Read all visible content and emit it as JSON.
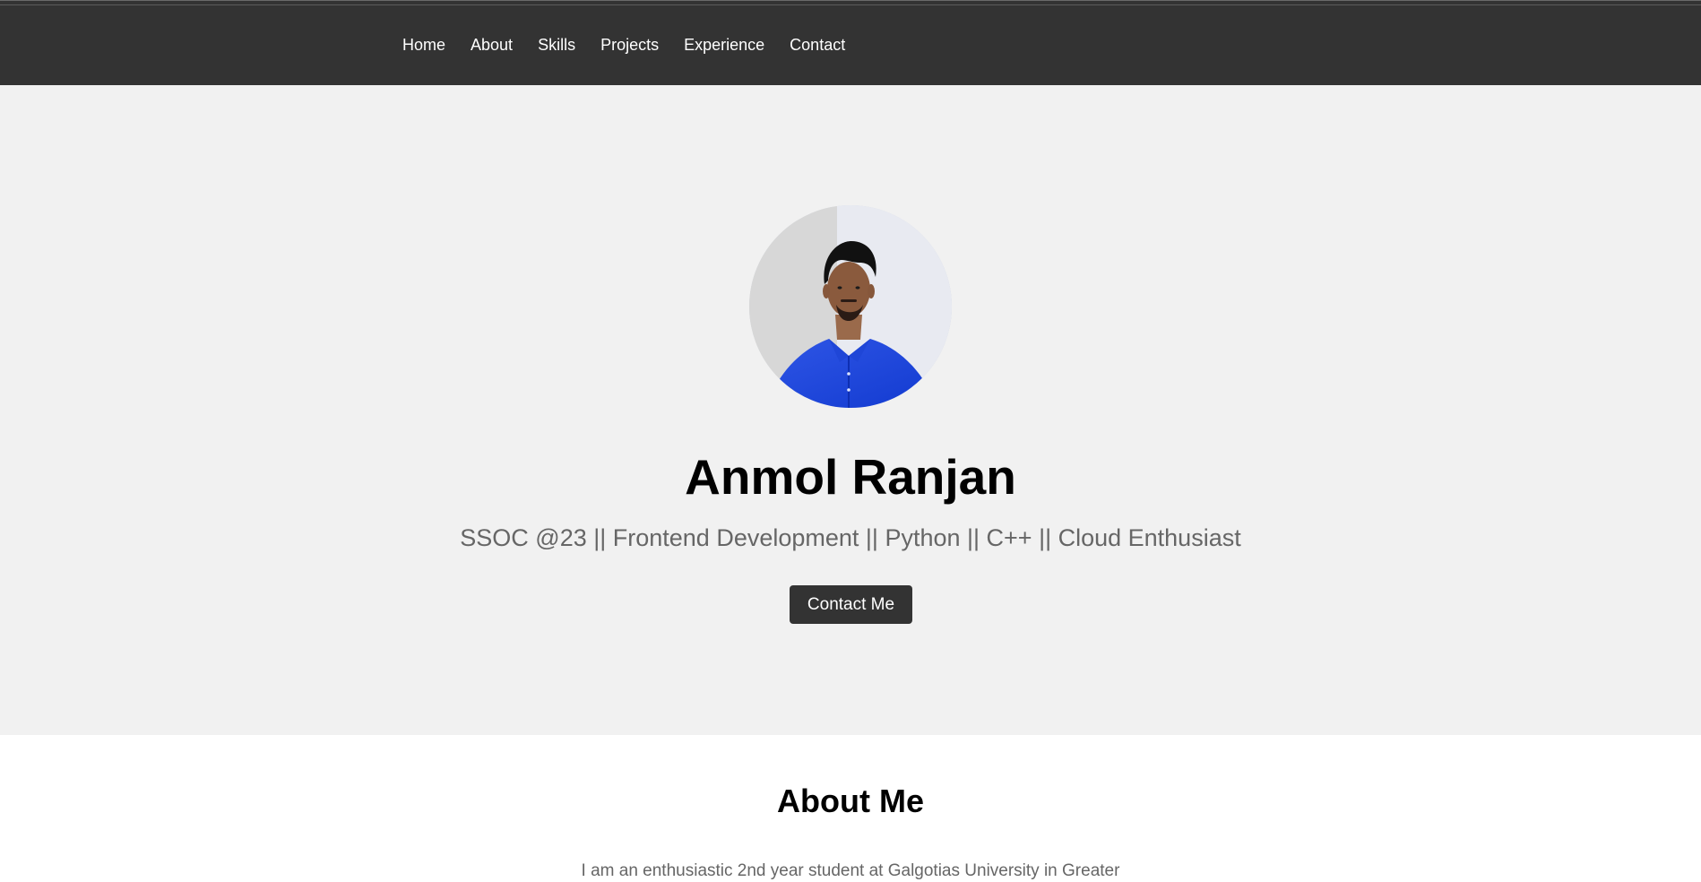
{
  "nav": {
    "items": [
      {
        "label": "Home"
      },
      {
        "label": "About"
      },
      {
        "label": "Skills"
      },
      {
        "label": "Projects"
      },
      {
        "label": "Experience"
      },
      {
        "label": "Contact"
      }
    ]
  },
  "hero": {
    "name": "Anmol Ranjan",
    "subtitle": "SSOC @23 || Frontend Development || Python || C++ || Cloud Enthusiast",
    "button_label": "Contact Me",
    "avatar": "profile-photo"
  },
  "about": {
    "title": "About Me",
    "intro_text": "I am an enthusiastic 2nd year student at Galgotias University in Greater"
  },
  "colors": {
    "nav_bg": "#333333",
    "hero_bg": "#f1f1f1",
    "button_bg": "#333333",
    "subtitle_text": "#666666",
    "about_bg": "#ffffff"
  }
}
